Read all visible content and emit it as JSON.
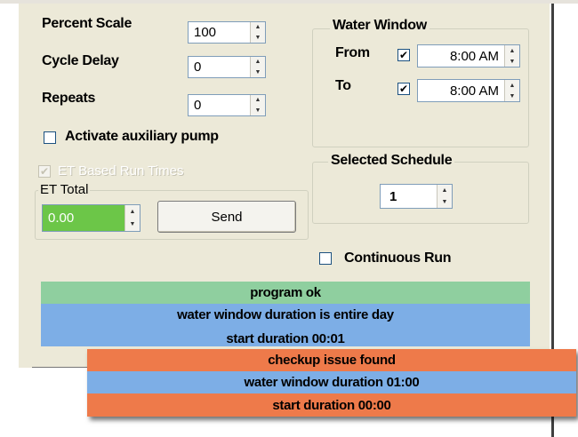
{
  "percent_scale": {
    "label": "Percent Scale",
    "value": "100"
  },
  "cycle_delay": {
    "label": "Cycle Delay",
    "value": "0"
  },
  "repeats": {
    "label": "Repeats",
    "value": "0"
  },
  "aux_pump": {
    "label": "Activate auxiliary pump",
    "checked": false
  },
  "et_seed": {
    "label": "ET Based Run Times",
    "checked": true,
    "disabled": true
  },
  "et_total": {
    "title": "ET Total",
    "value": "0.00",
    "send_label": "Send"
  },
  "water_window": {
    "title": "Water Window",
    "from": {
      "label": "From",
      "checked": true,
      "time": "8:00 AM"
    },
    "to": {
      "label": "To",
      "checked": true,
      "time": "8:00 AM"
    }
  },
  "selected_schedule": {
    "title": "Selected Schedule",
    "value": "1"
  },
  "continuous_run": {
    "label": "Continuous Run",
    "checked": false
  },
  "messages": [
    {
      "text": "program ok",
      "color": "#8fcf9f"
    },
    {
      "text": "water window duration is entire day",
      "color": "#7daee6"
    },
    {
      "text": "start duration 00:01",
      "color": "#7daee6"
    }
  ],
  "popup_messages": [
    {
      "text": "checkup issue found",
      "color": "#ee7a4a"
    },
    {
      "text": "water window duration 01:00",
      "color": "#7daee6"
    },
    {
      "text": "start duration 00:00",
      "color": "#ee7a4a"
    }
  ],
  "icons": {
    "spin_up": "▲",
    "spin_down": "▼",
    "check": "✔"
  }
}
